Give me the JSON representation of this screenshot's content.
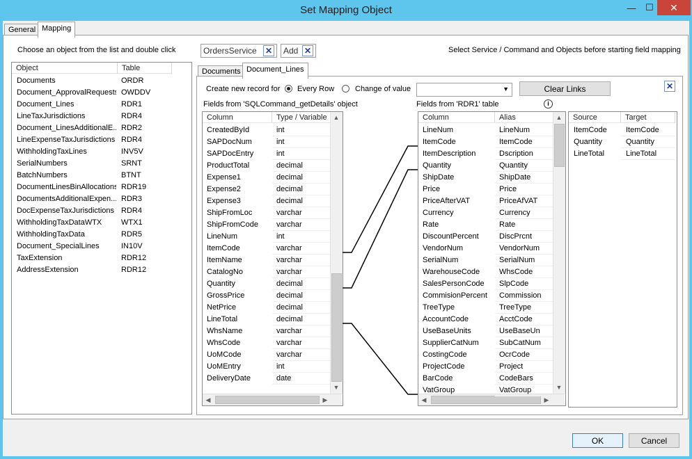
{
  "window": {
    "title": "Set Mapping Object",
    "minimize_glyph": "—",
    "maximize_glyph": "☐",
    "close_glyph": "✕"
  },
  "top_tabs": [
    {
      "label": "General"
    },
    {
      "label": "Mapping"
    }
  ],
  "left": {
    "instruction": "Choose an object from the list and double click",
    "columns": [
      "Object",
      "Table"
    ],
    "rows": [
      [
        "Documents",
        "ORDR"
      ],
      [
        "Document_ApprovalRequests",
        "OWDDV"
      ],
      [
        "Document_Lines",
        "RDR1"
      ],
      [
        "LineTaxJurisdictions",
        "RDR4"
      ],
      [
        "Document_LinesAdditionalE...",
        "RDR2"
      ],
      [
        "LineExpenseTaxJurisdictions",
        "RDR4"
      ],
      [
        "WithholdingTaxLines",
        "INV5V"
      ],
      [
        "SerialNumbers",
        "SRNT"
      ],
      [
        "BatchNumbers",
        "BTNT"
      ],
      [
        "DocumentLinesBinAllocations",
        "RDR19"
      ],
      [
        "DocumentsAdditionalExpen...",
        "RDR3"
      ],
      [
        "DocExpenseTaxJurisdictions",
        "RDR4"
      ],
      [
        "WithholdingTaxDataWTX",
        "WTX1"
      ],
      [
        "WithholdingTaxData",
        "RDR5"
      ],
      [
        "Document_SpecialLines",
        "IN10V"
      ],
      [
        "TaxExtension",
        "RDR12"
      ],
      [
        "AddressExtension",
        "RDR12"
      ]
    ]
  },
  "tokens": [
    {
      "label": "OrdersService"
    },
    {
      "label": "Add"
    }
  ],
  "hint": "Select Service / Command and Objects before starting field mapping",
  "inner_tabs": [
    {
      "label": "Documents"
    },
    {
      "label": "Document_Lines"
    }
  ],
  "options": {
    "create_label": "Create new record for",
    "every_row": "Every Row",
    "change_of_value": "Change of value",
    "combo_value": "",
    "clear_links": "Clear Links"
  },
  "source_grid": {
    "caption": "Fields from 'SQLCommand_getDetails' object",
    "columns": [
      "Column",
      "Type / Variable"
    ],
    "rows": [
      [
        "CreatedById",
        "int"
      ],
      [
        "SAPDocNum",
        "int"
      ],
      [
        "SAPDocEntry",
        "int"
      ],
      [
        "ProductTotal",
        "decimal"
      ],
      [
        "Expense1",
        "decimal"
      ],
      [
        "Expense2",
        "decimal"
      ],
      [
        "Expense3",
        "decimal"
      ],
      [
        "ShipFromLoc",
        "varchar"
      ],
      [
        "ShipFromCode",
        "varchar"
      ],
      [
        "LineNum",
        "int"
      ],
      [
        "ItemCode",
        "varchar"
      ],
      [
        "ItemName",
        "varchar"
      ],
      [
        "CatalogNo",
        "varchar"
      ],
      [
        "Quantity",
        "decimal"
      ],
      [
        "GrossPrice",
        "decimal"
      ],
      [
        "NetPrice",
        "decimal"
      ],
      [
        "LineTotal",
        "decimal"
      ],
      [
        "WhsName",
        "varchar"
      ],
      [
        "WhsCode",
        "varchar"
      ],
      [
        "UoMCode",
        "varchar"
      ],
      [
        "UoMEntry",
        "int"
      ],
      [
        "DeliveryDate",
        "date"
      ]
    ]
  },
  "target_grid": {
    "caption": "Fields from 'RDR1' table",
    "info_icon": "info-icon",
    "columns": [
      "Column",
      "Alias"
    ],
    "rows": [
      [
        "LineNum",
        "LineNum"
      ],
      [
        "ItemCode",
        "ItemCode"
      ],
      [
        "ItemDescription",
        "Dscription"
      ],
      [
        "Quantity",
        "Quantity"
      ],
      [
        "ShipDate",
        "ShipDate"
      ],
      [
        "Price",
        "Price"
      ],
      [
        "PriceAfterVAT",
        "PriceAfVAT"
      ],
      [
        "Currency",
        "Currency"
      ],
      [
        "Rate",
        "Rate"
      ],
      [
        "DiscountPercent",
        "DiscPrcnt"
      ],
      [
        "VendorNum",
        "VendorNum"
      ],
      [
        "SerialNum",
        "SerialNum"
      ],
      [
        "WarehouseCode",
        "WhsCode"
      ],
      [
        "SalesPersonCode",
        "SlpCode"
      ],
      [
        "CommisionPercent",
        "Commission"
      ],
      [
        "TreeType",
        "TreeType"
      ],
      [
        "AccountCode",
        "AcctCode"
      ],
      [
        "UseBaseUnits",
        "UseBaseUn"
      ],
      [
        "SupplierCatNum",
        "SubCatNum"
      ],
      [
        "CostingCode",
        "OcrCode"
      ],
      [
        "ProjectCode",
        "Project"
      ],
      [
        "BarCode",
        "CodeBars"
      ],
      [
        "VatGroup",
        "VatGroup"
      ]
    ]
  },
  "links_grid": {
    "columns": [
      "Source",
      "Target"
    ],
    "rows": [
      [
        "ItemCode",
        "ItemCode"
      ],
      [
        "Quantity",
        "Quantity"
      ],
      [
        "LineTotal",
        "LineTotal"
      ]
    ]
  },
  "links": [
    {
      "source": "ItemCode",
      "target": "ItemCode"
    },
    {
      "source": "Quantity",
      "target": "Quantity"
    },
    {
      "source": "LineTotal",
      "target": "VatGroup"
    }
  ],
  "footer": {
    "ok": "OK",
    "cancel": "Cancel"
  },
  "colors": {
    "titlebar": "#5ec6ec",
    "close": "#c9453a",
    "link_line": "#000000"
  }
}
